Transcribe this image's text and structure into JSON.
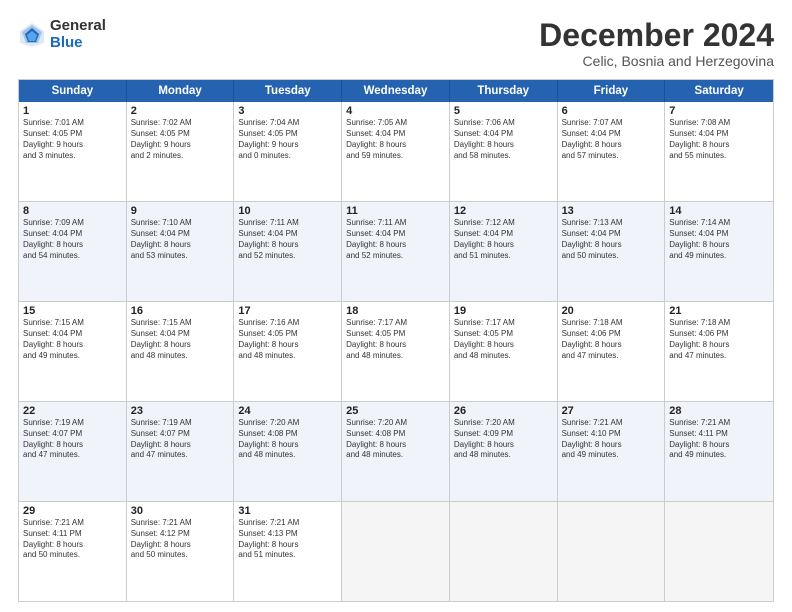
{
  "logo": {
    "general": "General",
    "blue": "Blue"
  },
  "title": "December 2024",
  "subtitle": "Celic, Bosnia and Herzegovina",
  "header_days": [
    "Sunday",
    "Monday",
    "Tuesday",
    "Wednesday",
    "Thursday",
    "Friday",
    "Saturday"
  ],
  "rows": [
    [
      {
        "day": "1",
        "lines": [
          "Sunrise: 7:01 AM",
          "Sunset: 4:05 PM",
          "Daylight: 9 hours",
          "and 3 minutes."
        ],
        "shaded": false
      },
      {
        "day": "2",
        "lines": [
          "Sunrise: 7:02 AM",
          "Sunset: 4:05 PM",
          "Daylight: 9 hours",
          "and 2 minutes."
        ],
        "shaded": false
      },
      {
        "day": "3",
        "lines": [
          "Sunrise: 7:04 AM",
          "Sunset: 4:05 PM",
          "Daylight: 9 hours",
          "and 0 minutes."
        ],
        "shaded": false
      },
      {
        "day": "4",
        "lines": [
          "Sunrise: 7:05 AM",
          "Sunset: 4:04 PM",
          "Daylight: 8 hours",
          "and 59 minutes."
        ],
        "shaded": false
      },
      {
        "day": "5",
        "lines": [
          "Sunrise: 7:06 AM",
          "Sunset: 4:04 PM",
          "Daylight: 8 hours",
          "and 58 minutes."
        ],
        "shaded": false
      },
      {
        "day": "6",
        "lines": [
          "Sunrise: 7:07 AM",
          "Sunset: 4:04 PM",
          "Daylight: 8 hours",
          "and 57 minutes."
        ],
        "shaded": false
      },
      {
        "day": "7",
        "lines": [
          "Sunrise: 7:08 AM",
          "Sunset: 4:04 PM",
          "Daylight: 8 hours",
          "and 55 minutes."
        ],
        "shaded": false
      }
    ],
    [
      {
        "day": "8",
        "lines": [
          "Sunrise: 7:09 AM",
          "Sunset: 4:04 PM",
          "Daylight: 8 hours",
          "and 54 minutes."
        ],
        "shaded": true
      },
      {
        "day": "9",
        "lines": [
          "Sunrise: 7:10 AM",
          "Sunset: 4:04 PM",
          "Daylight: 8 hours",
          "and 53 minutes."
        ],
        "shaded": true
      },
      {
        "day": "10",
        "lines": [
          "Sunrise: 7:11 AM",
          "Sunset: 4:04 PM",
          "Daylight: 8 hours",
          "and 52 minutes."
        ],
        "shaded": true
      },
      {
        "day": "11",
        "lines": [
          "Sunrise: 7:11 AM",
          "Sunset: 4:04 PM",
          "Daylight: 8 hours",
          "and 52 minutes."
        ],
        "shaded": true
      },
      {
        "day": "12",
        "lines": [
          "Sunrise: 7:12 AM",
          "Sunset: 4:04 PM",
          "Daylight: 8 hours",
          "and 51 minutes."
        ],
        "shaded": true
      },
      {
        "day": "13",
        "lines": [
          "Sunrise: 7:13 AM",
          "Sunset: 4:04 PM",
          "Daylight: 8 hours",
          "and 50 minutes."
        ],
        "shaded": true
      },
      {
        "day": "14",
        "lines": [
          "Sunrise: 7:14 AM",
          "Sunset: 4:04 PM",
          "Daylight: 8 hours",
          "and 49 minutes."
        ],
        "shaded": true
      }
    ],
    [
      {
        "day": "15",
        "lines": [
          "Sunrise: 7:15 AM",
          "Sunset: 4:04 PM",
          "Daylight: 8 hours",
          "and 49 minutes."
        ],
        "shaded": false
      },
      {
        "day": "16",
        "lines": [
          "Sunrise: 7:15 AM",
          "Sunset: 4:04 PM",
          "Daylight: 8 hours",
          "and 48 minutes."
        ],
        "shaded": false
      },
      {
        "day": "17",
        "lines": [
          "Sunrise: 7:16 AM",
          "Sunset: 4:05 PM",
          "Daylight: 8 hours",
          "and 48 minutes."
        ],
        "shaded": false
      },
      {
        "day": "18",
        "lines": [
          "Sunrise: 7:17 AM",
          "Sunset: 4:05 PM",
          "Daylight: 8 hours",
          "and 48 minutes."
        ],
        "shaded": false
      },
      {
        "day": "19",
        "lines": [
          "Sunrise: 7:17 AM",
          "Sunset: 4:05 PM",
          "Daylight: 8 hours",
          "and 48 minutes."
        ],
        "shaded": false
      },
      {
        "day": "20",
        "lines": [
          "Sunrise: 7:18 AM",
          "Sunset: 4:06 PM",
          "Daylight: 8 hours",
          "and 47 minutes."
        ],
        "shaded": false
      },
      {
        "day": "21",
        "lines": [
          "Sunrise: 7:18 AM",
          "Sunset: 4:06 PM",
          "Daylight: 8 hours",
          "and 47 minutes."
        ],
        "shaded": false
      }
    ],
    [
      {
        "day": "22",
        "lines": [
          "Sunrise: 7:19 AM",
          "Sunset: 4:07 PM",
          "Daylight: 8 hours",
          "and 47 minutes."
        ],
        "shaded": true
      },
      {
        "day": "23",
        "lines": [
          "Sunrise: 7:19 AM",
          "Sunset: 4:07 PM",
          "Daylight: 8 hours",
          "and 47 minutes."
        ],
        "shaded": true
      },
      {
        "day": "24",
        "lines": [
          "Sunrise: 7:20 AM",
          "Sunset: 4:08 PM",
          "Daylight: 8 hours",
          "and 48 minutes."
        ],
        "shaded": true
      },
      {
        "day": "25",
        "lines": [
          "Sunrise: 7:20 AM",
          "Sunset: 4:08 PM",
          "Daylight: 8 hours",
          "and 48 minutes."
        ],
        "shaded": true
      },
      {
        "day": "26",
        "lines": [
          "Sunrise: 7:20 AM",
          "Sunset: 4:09 PM",
          "Daylight: 8 hours",
          "and 48 minutes."
        ],
        "shaded": true
      },
      {
        "day": "27",
        "lines": [
          "Sunrise: 7:21 AM",
          "Sunset: 4:10 PM",
          "Daylight: 8 hours",
          "and 49 minutes."
        ],
        "shaded": true
      },
      {
        "day": "28",
        "lines": [
          "Sunrise: 7:21 AM",
          "Sunset: 4:11 PM",
          "Daylight: 8 hours",
          "and 49 minutes."
        ],
        "shaded": true
      }
    ],
    [
      {
        "day": "29",
        "lines": [
          "Sunrise: 7:21 AM",
          "Sunset: 4:11 PM",
          "Daylight: 8 hours",
          "and 50 minutes."
        ],
        "shaded": false
      },
      {
        "day": "30",
        "lines": [
          "Sunrise: 7:21 AM",
          "Sunset: 4:12 PM",
          "Daylight: 8 hours",
          "and 50 minutes."
        ],
        "shaded": false
      },
      {
        "day": "31",
        "lines": [
          "Sunrise: 7:21 AM",
          "Sunset: 4:13 PM",
          "Daylight: 8 hours",
          "and 51 minutes."
        ],
        "shaded": false
      },
      {
        "day": "",
        "lines": [],
        "shaded": false,
        "empty": true
      },
      {
        "day": "",
        "lines": [],
        "shaded": false,
        "empty": true
      },
      {
        "day": "",
        "lines": [],
        "shaded": false,
        "empty": true
      },
      {
        "day": "",
        "lines": [],
        "shaded": false,
        "empty": true
      }
    ]
  ]
}
